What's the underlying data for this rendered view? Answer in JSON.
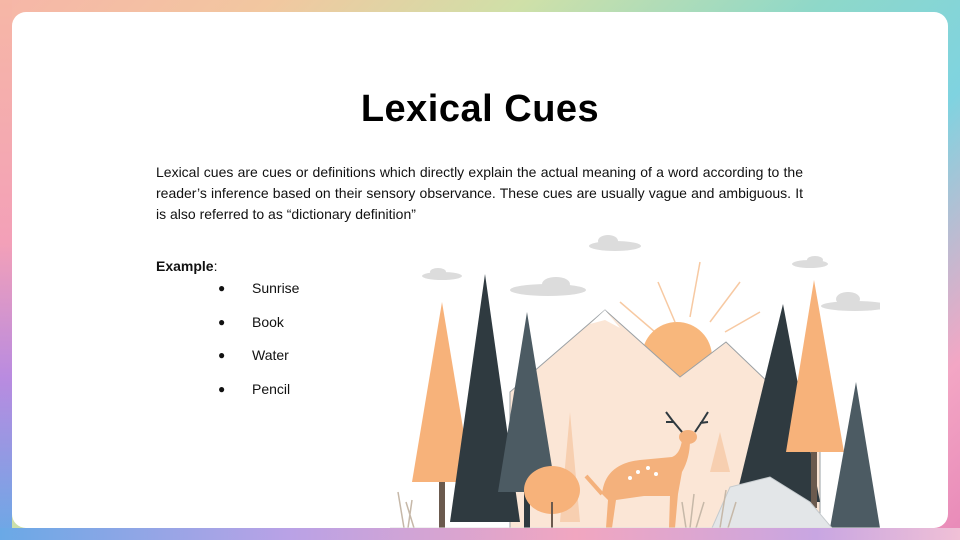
{
  "slide": {
    "title": "Lexical Cues",
    "description": "Lexical cues are cues or definitions which directly explain the actual meaning of a word according to the reader’s inference based on their sensory observance. These cues are usually vague and ambiguous. It is also referred to as “dictionary definition”",
    "example_label": "Example",
    "example_colon": ":",
    "examples": [
      "Sunrise",
      "Book",
      "Water",
      "Pencil"
    ],
    "bullet_char": "●"
  },
  "illustration": {
    "icon": "forest-deer-illustration",
    "colors": {
      "orange": "#f7b27a",
      "dark_tree": "#2f3a40",
      "slate_tree": "#4c5b63",
      "mountain": "#fbe6d6",
      "sun": "#f8b77c",
      "cloud": "#dcdcdc"
    }
  }
}
